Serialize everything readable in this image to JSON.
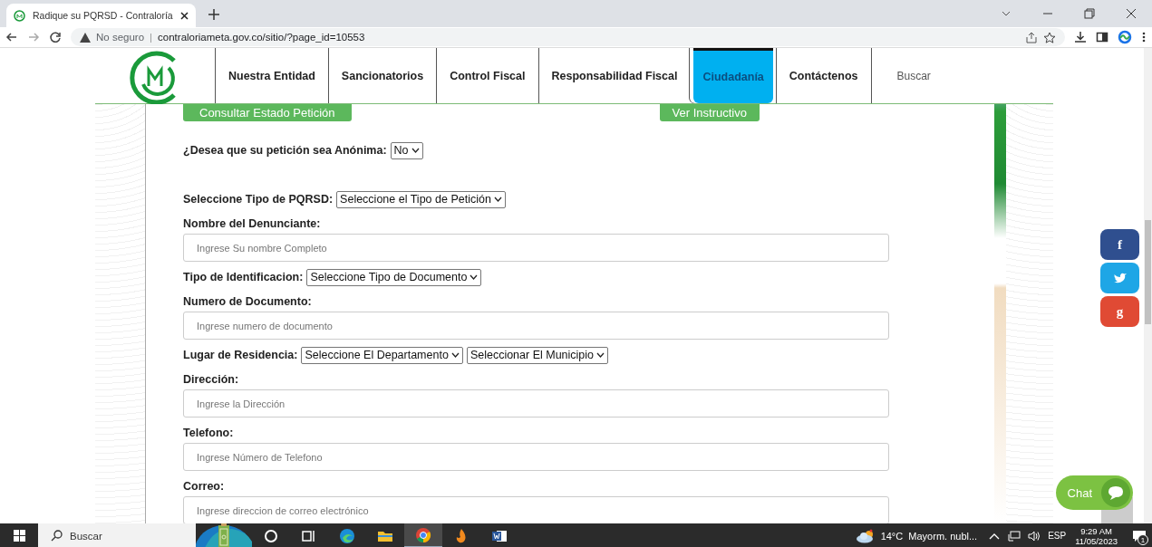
{
  "browser": {
    "tab_title": "Radique su PQRSD - Contraloría",
    "security": "No seguro",
    "separator": "|",
    "url": "contraloriameta.gov.co/sitio/?page_id=10553"
  },
  "nav": {
    "items": [
      {
        "label": "Nuestra Entidad",
        "selected": false
      },
      {
        "label": "Sancionatorios",
        "selected": false
      },
      {
        "label": "Control Fiscal",
        "selected": false
      },
      {
        "label": "Responsabilidad Fiscal",
        "selected": false
      },
      {
        "label": "Ciudadanía",
        "selected": true
      },
      {
        "label": "Contáctenos",
        "selected": false
      }
    ],
    "search_placeholder": "Buscar"
  },
  "actions": [
    "Consultar Estado Petición",
    "Ver Instructivo"
  ],
  "form": [
    {
      "kind": "select",
      "label": "¿Desea que su petición sea Anónima:",
      "selects": [
        "No"
      ]
    },
    {
      "kind": "select",
      "label": "Seleccione Tipo de PQRSD:",
      "selects": [
        "Seleccione el Tipo de Petición"
      ]
    },
    {
      "kind": "input",
      "label": "Nombre del Denunciante:",
      "placeholder": "Ingrese Su nombre Completo"
    },
    {
      "kind": "select",
      "label": "Tipo de Identificacion:",
      "selects": [
        "Seleccione Tipo de Documento"
      ]
    },
    {
      "kind": "input",
      "label": "Numero de Documento:",
      "placeholder": "Ingrese numero de documento"
    },
    {
      "kind": "select",
      "label": "Lugar de Residencia:",
      "selects": [
        "Seleccione El Departamento",
        "Seleccionar El Municipio"
      ]
    },
    {
      "kind": "input",
      "label": "Dirección:",
      "placeholder": "Ingrese la Dirección"
    },
    {
      "kind": "input",
      "label": "Telefono:",
      "placeholder": "Ingrese Número de Telefono"
    },
    {
      "kind": "input",
      "label": "Correo:",
      "placeholder": "Ingrese direccion de correo electrónico"
    }
  ],
  "social": [
    {
      "kind": "letter",
      "text": "f",
      "color": "#2f4f8f"
    },
    {
      "kind": "bird",
      "color": "#1ea6e6"
    },
    {
      "kind": "letter",
      "text": "g",
      "color": "#e04a34"
    }
  ],
  "chat": "Chat",
  "taskbar": {
    "search": "Buscar",
    "apps": [
      {
        "kind": "circle",
        "selected": false
      },
      {
        "kind": "taskview",
        "selected": false
      },
      {
        "kind": "edge",
        "selected": false
      },
      {
        "kind": "folder",
        "selected": false
      },
      {
        "kind": "chrome",
        "selected": true
      },
      {
        "kind": "flame",
        "selected": false
      },
      {
        "kind": "word",
        "selected": false
      }
    ],
    "temperature": "14°C",
    "weather": "Mayorm. nubl...",
    "language": "ESP",
    "time": "9:29 AM",
    "date": "11/05/2023",
    "notifications": "1"
  }
}
